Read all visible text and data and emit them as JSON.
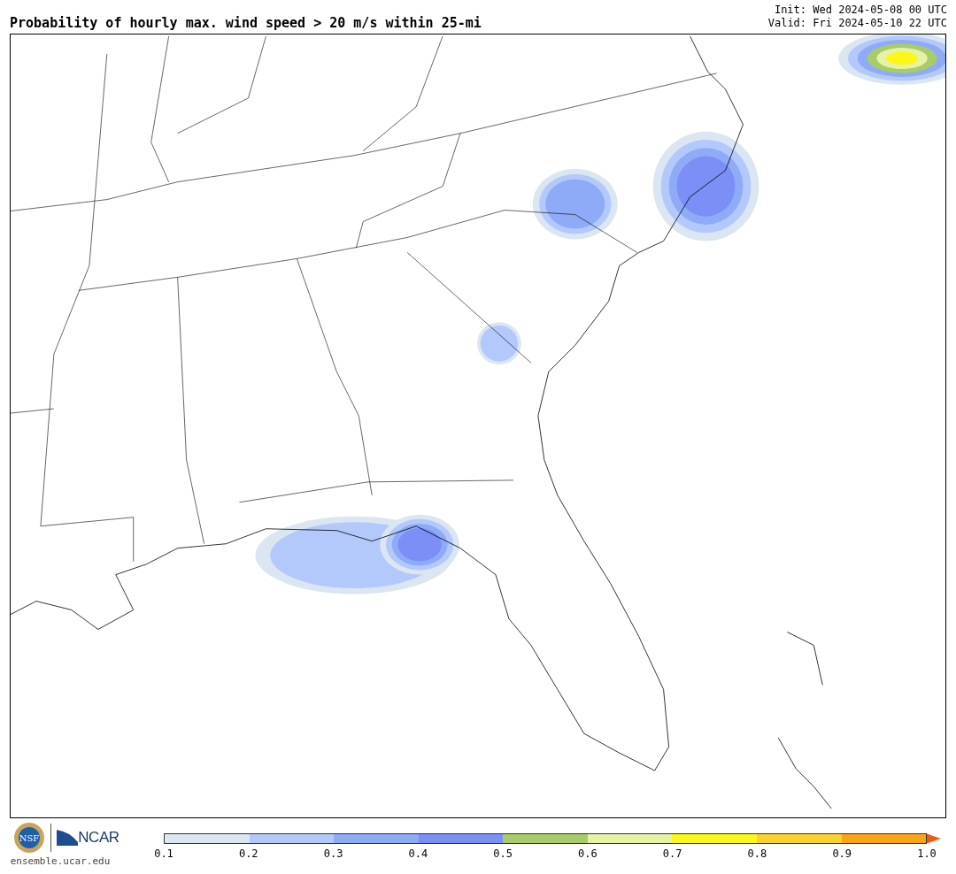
{
  "title": "Probability of hourly max. wind speed > 20 m/s within 25-mi",
  "init": "Init: Wed 2024-05-08 00 UTC",
  "valid": "Valid: Fri 2024-05-10 22 UTC",
  "logos": {
    "seal_text": "NSF",
    "wordmark": "NCAR",
    "url": "ensemble.ucar.edu"
  },
  "colorbar": {
    "bins": [
      {
        "color": "#dbe6f2"
      },
      {
        "color": "#b4c9fb"
      },
      {
        "color": "#8fabf8"
      },
      {
        "color": "#7b8ff7"
      },
      {
        "color": "#a8cc6a"
      },
      {
        "color": "#e6f2a5"
      },
      {
        "color": "#fdf716"
      },
      {
        "color": "#fdd12c"
      },
      {
        "color": "#fca414"
      }
    ],
    "extend_arrow": {
      "color": "#f25a0f"
    },
    "ticks": [
      "0.1",
      "0.2",
      "0.3",
      "0.4",
      "0.5",
      "0.6",
      "0.7",
      "0.8",
      "0.9",
      "1.0"
    ]
  }
}
